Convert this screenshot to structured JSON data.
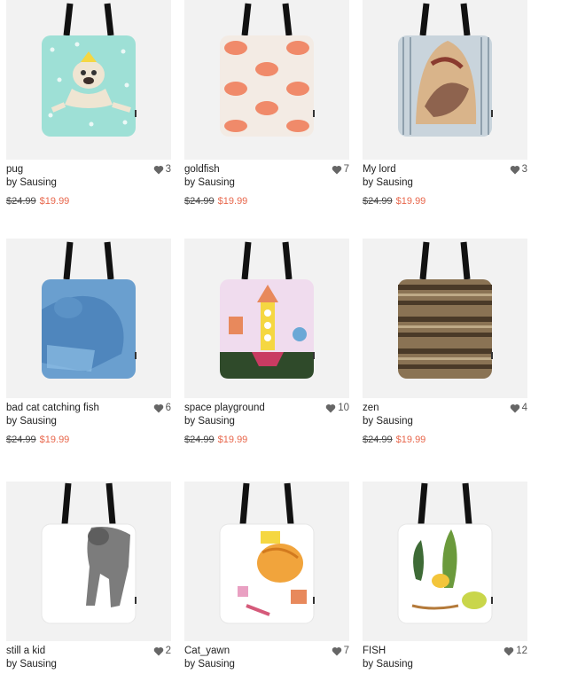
{
  "products": [
    {
      "title": "pug",
      "artist": "by Sausing",
      "likes": "3",
      "old_price": "$24.99",
      "new_price": "$19.99",
      "art": "pug-illustration"
    },
    {
      "title": "goldfish",
      "artist": "by Sausing",
      "likes": "7",
      "old_price": "$24.99",
      "new_price": "$19.99",
      "art": "goldfish-pattern"
    },
    {
      "title": "My lord",
      "artist": "by Sausing",
      "likes": "3",
      "old_price": "$24.99",
      "new_price": "$19.99",
      "art": "striped-painting"
    },
    {
      "title": "bad cat catching fish",
      "artist": "by Sausing",
      "likes": "6",
      "old_price": "$24.99",
      "new_price": "$19.99",
      "art": "blue-cat-photo"
    },
    {
      "title": "space playground",
      "artist": "by Sausing",
      "likes": "10",
      "old_price": "$24.99",
      "new_price": "$19.99",
      "art": "rocket-drawing"
    },
    {
      "title": "zen",
      "artist": "by Sausing",
      "likes": "4",
      "old_price": "$24.99",
      "new_price": "$19.99",
      "art": "wood-stripes"
    },
    {
      "title": "still a kid",
      "artist": "by Sausing",
      "likes": "2",
      "old_price": "",
      "new_price": "",
      "art": "grey-cat-photo"
    },
    {
      "title": "Cat_yawn",
      "artist": "by Sausing",
      "likes": "7",
      "old_price": "",
      "new_price": "",
      "art": "orange-cat-drawing"
    },
    {
      "title": "FISH",
      "artist": "by Sausing",
      "likes": "12",
      "old_price": "",
      "new_price": "",
      "art": "plants-fish-drawing"
    }
  ],
  "colors": {
    "sale_price": "#e8664b",
    "heart": "#666666",
    "thumb_bg": "#f2f2f2"
  },
  "icons": {
    "like": "heart-icon"
  }
}
